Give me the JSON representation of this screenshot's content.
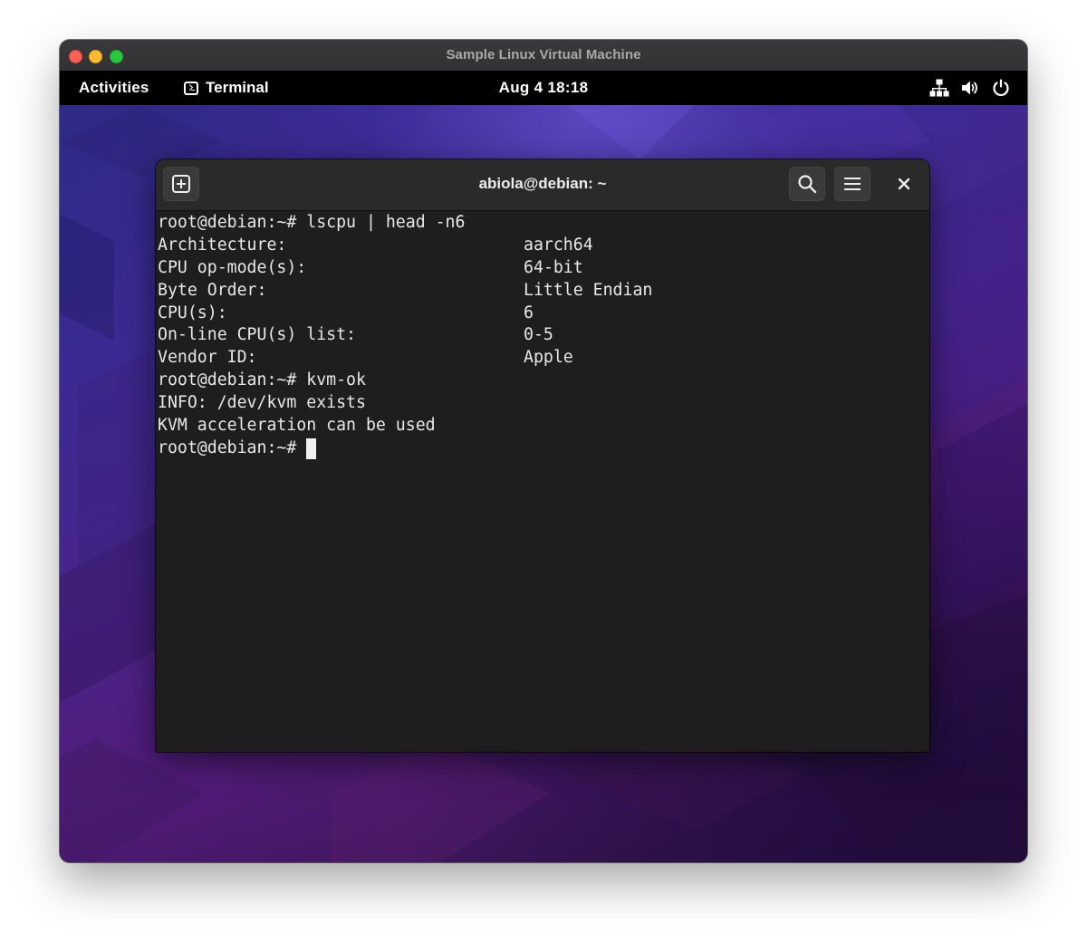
{
  "mac_window": {
    "title": "Sample Linux Virtual Machine"
  },
  "gnome_bar": {
    "activities": "Activities",
    "app_name": "Terminal",
    "clock": "Aug 4  18:18",
    "tray_icons": [
      "network-icon",
      "volume-icon",
      "power-icon"
    ]
  },
  "terminal": {
    "title": "abiola@debian: ~",
    "header_icons": [
      "new-tab-icon",
      "search-icon",
      "hamburger-menu-icon",
      "close-icon"
    ],
    "lines": {
      "l0": "root@debian:~# lscpu | head -n6",
      "l1_key": "Architecture:",
      "l1_val": "aarch64",
      "l2_key": "CPU op-mode(s):",
      "l2_val": "64-bit",
      "l3_key": "Byte Order:",
      "l3_val": "Little Endian",
      "l4_key": "CPU(s):",
      "l4_val": "6",
      "l5_key": "On-line CPU(s) list:",
      "l5_val": "0-5",
      "l6_key": "Vendor ID:",
      "l6_val": "Apple",
      "l7": "root@debian:~# kvm-ok",
      "l8": "INFO: /dev/kvm exists",
      "l9": "KVM acceleration can be used",
      "l10": "root@debian:~#"
    }
  },
  "colors": {
    "wallpaper_primary": "#47258b",
    "terminal_bg": "#1e1e1e",
    "terminal_header_bg": "#2a2a2a",
    "mac_close": "#fe5f57",
    "mac_minimize": "#febc2e",
    "mac_maximize": "#28c840"
  }
}
